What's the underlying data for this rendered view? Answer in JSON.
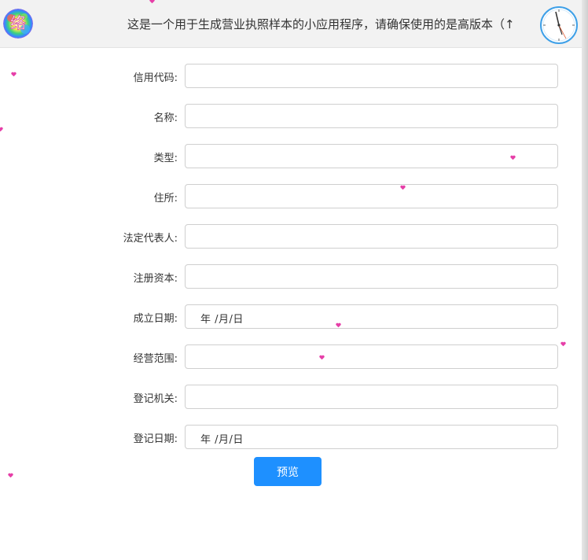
{
  "header": {
    "logo_text": "络",
    "marquee_text": "这是一个用于生成营业执照样本的小应用程序，请确保使用的是高版本（↑"
  },
  "form": {
    "fields": [
      {
        "label": "信用代码:",
        "value": ""
      },
      {
        "label": "名称:",
        "value": ""
      },
      {
        "label": "类型:",
        "value": ""
      },
      {
        "label": "住所:",
        "value": ""
      },
      {
        "label": "法定代表人:",
        "value": ""
      },
      {
        "label": "注册资本:",
        "value": ""
      },
      {
        "label": "成立日期:",
        "value": "年 /月/日"
      },
      {
        "label": "经营范围:",
        "value": ""
      },
      {
        "label": "登记机关:",
        "value": ""
      },
      {
        "label": "登记日期:",
        "value": "年 /月/日"
      }
    ],
    "preview_label": "预览"
  },
  "colors": {
    "accent": "#1e90ff",
    "heart": "#e63fa8"
  },
  "icons": {
    "logo": "logo-icon",
    "clock": "clock-icon",
    "heart": "heart-icon"
  }
}
